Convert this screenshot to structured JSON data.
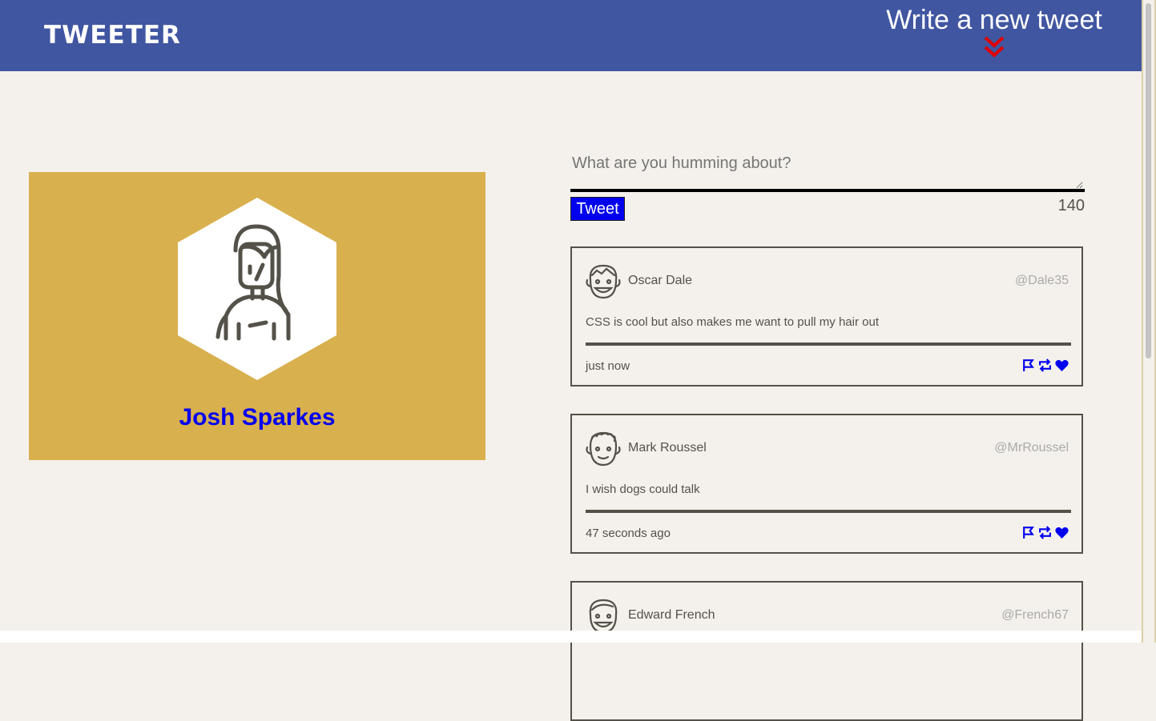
{
  "nav": {
    "brand": "TWEETER",
    "compose_label": "Write a new tweet"
  },
  "profile": {
    "name": "Josh Sparkes"
  },
  "composer": {
    "placeholder": "What are you humming about?",
    "button_label": "Tweet",
    "counter": "140"
  },
  "tweets": [
    {
      "name": "Oscar Dale",
      "handle": "@Dale35",
      "content": "CSS is cool but also makes me want to pull my hair out",
      "time": "just now"
    },
    {
      "name": "Mark Roussel",
      "handle": "@MrRoussel",
      "content": "I wish dogs could talk",
      "time": "47 seconds ago"
    },
    {
      "name": "Edward French",
      "handle": "@French67",
      "content": "",
      "time": ""
    }
  ],
  "colors": {
    "nav_bg": "#4056a1",
    "page_bg": "#f4f1ec",
    "card_bg": "#d9b04e",
    "accent_blue": "#0000ee",
    "chevron_red": "#e00000",
    "text": "#545149"
  },
  "icons": {
    "compose": "double-chevron-down-icon",
    "tweet_actions": [
      "flag-icon",
      "retweet-icon",
      "heart-icon"
    ]
  }
}
